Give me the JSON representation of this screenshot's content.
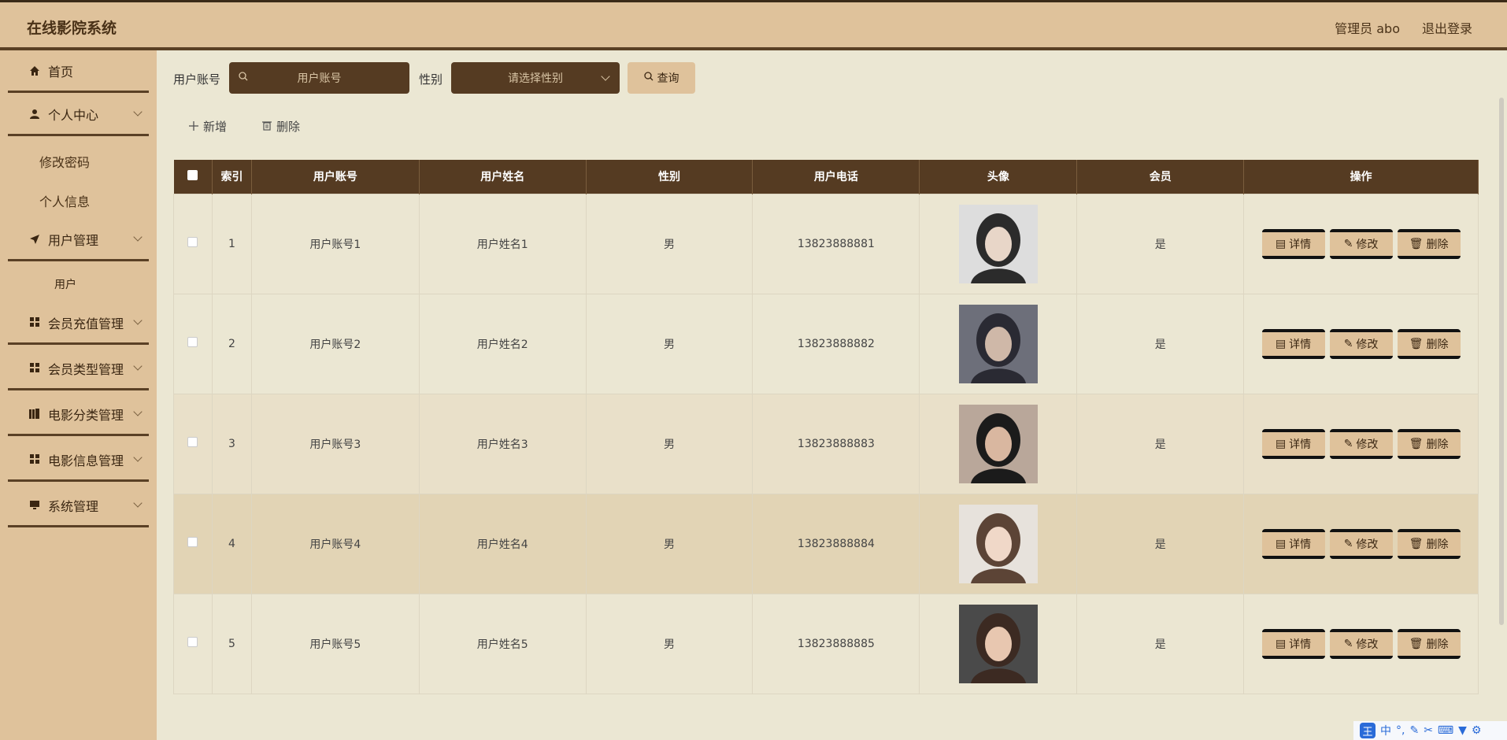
{
  "app_title": "在线影院系统",
  "header": {
    "user_label": "管理员 abo",
    "logout_label": "退出登录"
  },
  "sidebar": {
    "home": "首页",
    "personal_center": "个人中心",
    "change_password": "修改密码",
    "personal_info": "个人信息",
    "user_management": "用户管理",
    "user": "用户",
    "member_recharge": "会员充值管理",
    "member_type": "会员类型管理",
    "movie_category": "电影分类管理",
    "movie_info": "电影信息管理",
    "system": "系统管理"
  },
  "search": {
    "account_label": "用户账号",
    "account_placeholder": "用户账号",
    "gender_label": "性别",
    "gender_placeholder": "请选择性别",
    "query_label": "查询"
  },
  "toolbar": {
    "add_label": "新增",
    "delete_label": "删除"
  },
  "table": {
    "headers": [
      "索引",
      "用户账号",
      "用户姓名",
      "性别",
      "用户电话",
      "头像",
      "会员",
      "操作"
    ],
    "rows": [
      {
        "index": "1",
        "account": "用户账号1",
        "name": "用户姓名1",
        "gender": "男",
        "phone": "13823888881",
        "member": "是"
      },
      {
        "index": "2",
        "account": "用户账号2",
        "name": "用户姓名2",
        "gender": "男",
        "phone": "13823888882",
        "member": "是"
      },
      {
        "index": "3",
        "account": "用户账号3",
        "name": "用户姓名3",
        "gender": "男",
        "phone": "13823888883",
        "member": "是"
      },
      {
        "index": "4",
        "account": "用户账号4",
        "name": "用户姓名4",
        "gender": "男",
        "phone": "13823888884",
        "member": "是"
      },
      {
        "index": "5",
        "account": "用户账号5",
        "name": "用户姓名5",
        "gender": "男",
        "phone": "13823888885",
        "member": "是"
      }
    ],
    "actions": {
      "detail": "详情",
      "edit": "修改",
      "delete": "删除"
    }
  },
  "ime": {
    "logo": "王",
    "mode": "中"
  }
}
